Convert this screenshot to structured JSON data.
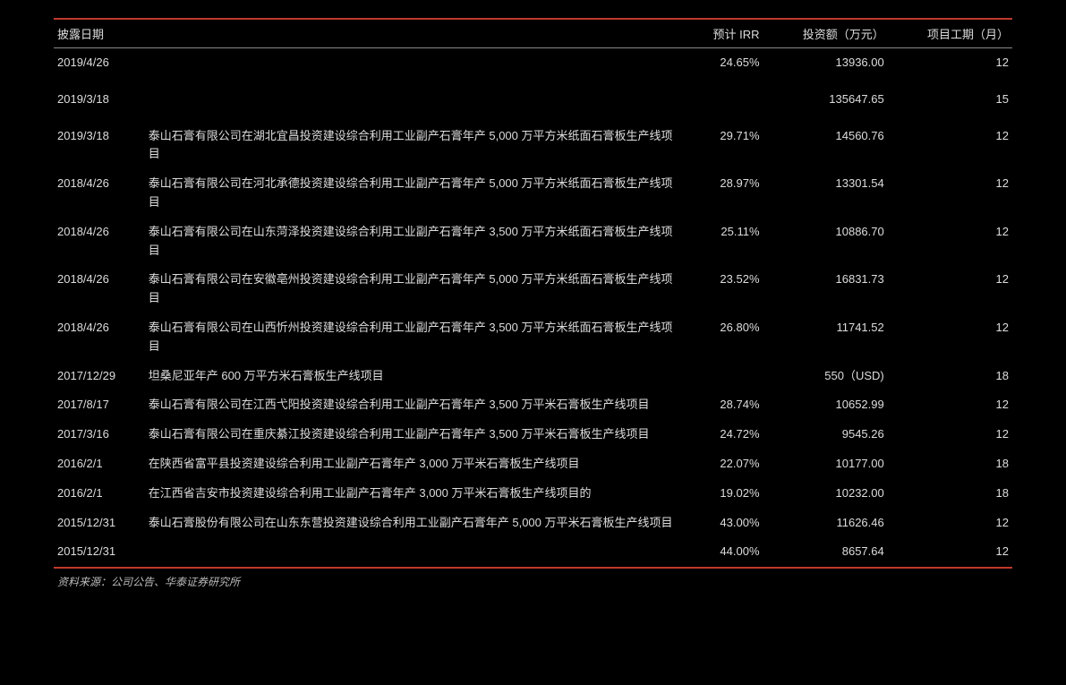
{
  "chart_data": {
    "type": "table",
    "headers": {
      "date": "披露日期",
      "desc": "",
      "irr": "预计 IRR",
      "investment": "投资额（万元）",
      "duration": "项目工期（月）"
    },
    "rows": [
      {
        "date": "2019/4/26",
        "desc": "",
        "irr": "24.65%",
        "investment": "13936.00",
        "duration": "12"
      },
      {
        "date": "2019/3/18",
        "desc": "",
        "irr": "",
        "investment": "135647.65",
        "duration": "15"
      },
      {
        "date": "2019/3/18",
        "desc": "泰山石膏有限公司在湖北宜昌投资建设综合利用工业副产石膏年产 5,000 万平方米纸面石膏板生产线项目",
        "irr": "29.71%",
        "investment": "14560.76",
        "duration": "12"
      },
      {
        "date": "2018/4/26",
        "desc": "泰山石膏有限公司在河北承德投资建设综合利用工业副产石膏年产 5,000 万平方米纸面石膏板生产线项目",
        "irr": "28.97%",
        "investment": "13301.54",
        "duration": "12"
      },
      {
        "date": "2018/4/26",
        "desc": "泰山石膏有限公司在山东菏泽投资建设综合利用工业副产石膏年产 3,500 万平方米纸面石膏板生产线项目",
        "irr": "25.11%",
        "investment": "10886.70",
        "duration": "12"
      },
      {
        "date": "2018/4/26",
        "desc": "泰山石膏有限公司在安徽亳州投资建设综合利用工业副产石膏年产 5,000 万平方米纸面石膏板生产线项目",
        "irr": "23.52%",
        "investment": "16831.73",
        "duration": "12"
      },
      {
        "date": "2018/4/26",
        "desc": "泰山石膏有限公司在山西忻州投资建设综合利用工业副产石膏年产 3,500 万平方米纸面石膏板生产线项目",
        "irr": "26.80%",
        "investment": "11741.52",
        "duration": "12"
      },
      {
        "date": "2017/12/29",
        "desc": "坦桑尼亚年产 600 万平方米石膏板生产线项目",
        "irr": "",
        "investment": "550（USD)",
        "duration": "18"
      },
      {
        "date": "2017/8/17",
        "desc": "泰山石膏有限公司在江西弋阳投资建设综合利用工业副产石膏年产 3,500 万平米石膏板生产线项目",
        "irr": "28.74%",
        "investment": "10652.99",
        "duration": "12"
      },
      {
        "date": "2017/3/16",
        "desc": "泰山石膏有限公司在重庆綦江投资建设综合利用工业副产石膏年产 3,500 万平米石膏板生产线项目",
        "irr": "24.72%",
        "investment": "9545.26",
        "duration": "12"
      },
      {
        "date": "2016/2/1",
        "desc": "在陕西省富平县投资建设综合利用工业副产石膏年产 3,000 万平米石膏板生产线项目",
        "irr": "22.07%",
        "investment": "10177.00",
        "duration": "18"
      },
      {
        "date": "2016/2/1",
        "desc": "在江西省吉安市投资建设综合利用工业副产石膏年产 3,000 万平米石膏板生产线项目的",
        "irr": "19.02%",
        "investment": "10232.00",
        "duration": "18"
      },
      {
        "date": "2015/12/31",
        "desc": "泰山石膏股份有限公司在山东东营投资建设综合利用工业副产石膏年产 5,000 万平米石膏板生产线项目",
        "irr": "43.00%",
        "investment": "11626.46",
        "duration": "12"
      },
      {
        "date": "2015/12/31",
        "desc": "",
        "irr": "44.00%",
        "investment": "8657.64",
        "duration": "12"
      }
    ]
  },
  "source": "资料来源：公司公告、华泰证券研究所"
}
